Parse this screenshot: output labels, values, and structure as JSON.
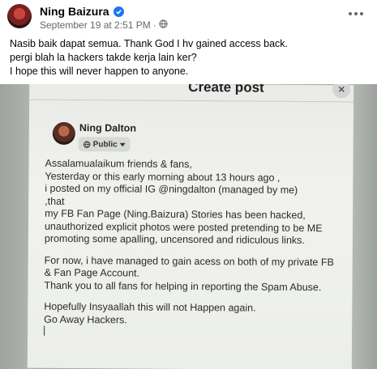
{
  "post": {
    "author": "Ning Baizura",
    "timestamp": "September 19 at 2:51 PM",
    "separator": "·",
    "privacy_icon": "globe-icon",
    "lines": [
      "Nasib baik dapat semua. Thank God I hv gained access back.",
      "pergi blah la hackers takde kerja lain ker?",
      "I hope this will never happen to anyone."
    ]
  },
  "photo": {
    "title": "Create post",
    "name": "Ning Dalton",
    "audience": "Public",
    "paragraph1": [
      "Assalamualaikum  friends & fans,",
      "Yesterday or this early morning about 13 hours ago ,",
      " i posted  on my official IG @ningdalton (managed by me)",
      " ,that",
      "my FB Fan Page (Ning.Baizura)  Stories has been hacked,",
      "unauthorized explicit photos were posted pretending to be ME",
      "promoting some apalling, uncensored and ridiculous links."
    ],
    "paragraph2": [
      "For now, i have managed to gain acess on both of my private FB",
      "& Fan Page Account.",
      "Thank you to all fans for helping in reporting the Spam Abuse."
    ],
    "paragraph3": [
      "Hopefully Insyaallah this will not Happen again.",
      "Go Away Hackers."
    ]
  }
}
